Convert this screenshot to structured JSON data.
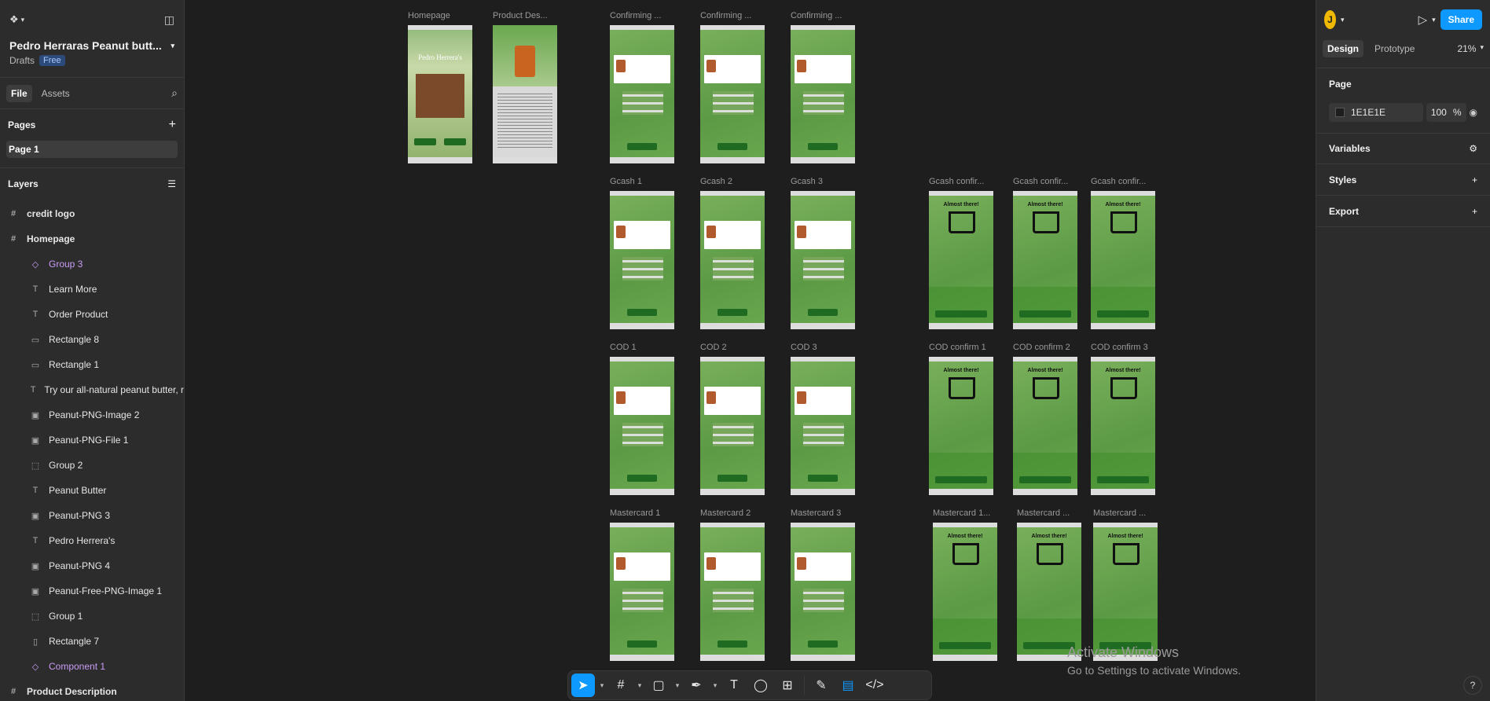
{
  "file": {
    "title": "Pedro Herraras Peanut butt...",
    "location": "Drafts",
    "plan": "Free"
  },
  "left_tabs": [
    "File",
    "Assets"
  ],
  "pages": {
    "header": "Pages",
    "items": [
      "Page 1"
    ]
  },
  "layers": {
    "header": "Layers",
    "items": [
      {
        "label": "credit logo",
        "icon": "#",
        "kind": "top"
      },
      {
        "label": "Homepage",
        "icon": "#",
        "kind": "top"
      },
      {
        "label": "Group 3",
        "icon": "◇",
        "kind": "child-purple"
      },
      {
        "label": "Learn More",
        "icon": "T",
        "kind": "child"
      },
      {
        "label": "Order Product",
        "icon": "T",
        "kind": "child"
      },
      {
        "label": "Rectangle 8",
        "icon": "▭",
        "kind": "child"
      },
      {
        "label": "Rectangle 1",
        "icon": "▭",
        "kind": "child"
      },
      {
        "label": "Try our all-natural peanut butter, r",
        "icon": "T",
        "kind": "child"
      },
      {
        "label": "Peanut-PNG-Image 2",
        "icon": "▣",
        "kind": "child"
      },
      {
        "label": "Peanut-PNG-File 1",
        "icon": "▣",
        "kind": "child"
      },
      {
        "label": "Group 2",
        "icon": "⬚",
        "kind": "child"
      },
      {
        "label": "Peanut Butter",
        "icon": "T",
        "kind": "child"
      },
      {
        "label": "Peanut-PNG 3",
        "icon": "▣",
        "kind": "child"
      },
      {
        "label": "Pedro Herrera's",
        "icon": "T",
        "kind": "child"
      },
      {
        "label": "Peanut-PNG 4",
        "icon": "▣",
        "kind": "child"
      },
      {
        "label": "Peanut-Free-PNG-Image 1",
        "icon": "▣",
        "kind": "child"
      },
      {
        "label": "Group 1",
        "icon": "⬚",
        "kind": "child"
      },
      {
        "label": "Rectangle 7",
        "icon": "▯",
        "kind": "child"
      },
      {
        "label": "Component 1",
        "icon": "◇",
        "kind": "child-purple"
      },
      {
        "label": "Product Description",
        "icon": "#",
        "kind": "top"
      }
    ]
  },
  "canvas": {
    "frames": [
      {
        "label": "Homepage",
        "type": "home",
        "home_title": "Pedro Herrera's"
      },
      {
        "label": "Product Des...",
        "type": "prod"
      },
      {
        "label": "Confirming ...",
        "type": "checkout"
      },
      {
        "label": "Confirming ...",
        "type": "checkout"
      },
      {
        "label": "Confirming ...",
        "type": "checkout"
      },
      {
        "label": "Gcash 1",
        "type": "checkout"
      },
      {
        "label": "Gcash 2",
        "type": "checkout"
      },
      {
        "label": "Gcash 3",
        "type": "checkout"
      },
      {
        "label": "Gcash confir...",
        "type": "confirm"
      },
      {
        "label": "Gcash confir...",
        "type": "confirm"
      },
      {
        "label": "Gcash confir...",
        "type": "confirm"
      },
      {
        "label": "COD 1",
        "type": "checkout"
      },
      {
        "label": "COD 2",
        "type": "checkout"
      },
      {
        "label": "COD 3",
        "type": "checkout"
      },
      {
        "label": "COD confirm 1",
        "type": "confirm"
      },
      {
        "label": "COD confirm 2",
        "type": "confirm"
      },
      {
        "label": "COD confirm 3",
        "type": "confirm"
      },
      {
        "label": "Mastercard 1",
        "type": "checkout"
      },
      {
        "label": "Mastercard 2",
        "type": "checkout"
      },
      {
        "label": "Mastercard 3",
        "type": "checkout"
      },
      {
        "label": "Mastercard 1...",
        "type": "confirm"
      },
      {
        "label": "Mastercard ...",
        "type": "confirm"
      },
      {
        "label": "Mastercard ...",
        "type": "confirm"
      }
    ],
    "confirm_title": "Almost there!"
  },
  "watermark": {
    "line1": "Activate Windows",
    "line2": "Go to Settings to activate Windows."
  },
  "user_initial": "J",
  "share_label": "Share",
  "right_tabs": [
    "Design",
    "Prototype"
  ],
  "zoom": "21%",
  "right": {
    "page_header": "Page",
    "bg_color": "1E1E1E",
    "opacity": "100",
    "opacity_unit": "%",
    "sections": [
      "Variables",
      "Styles",
      "Export"
    ]
  },
  "help_label": "?"
}
